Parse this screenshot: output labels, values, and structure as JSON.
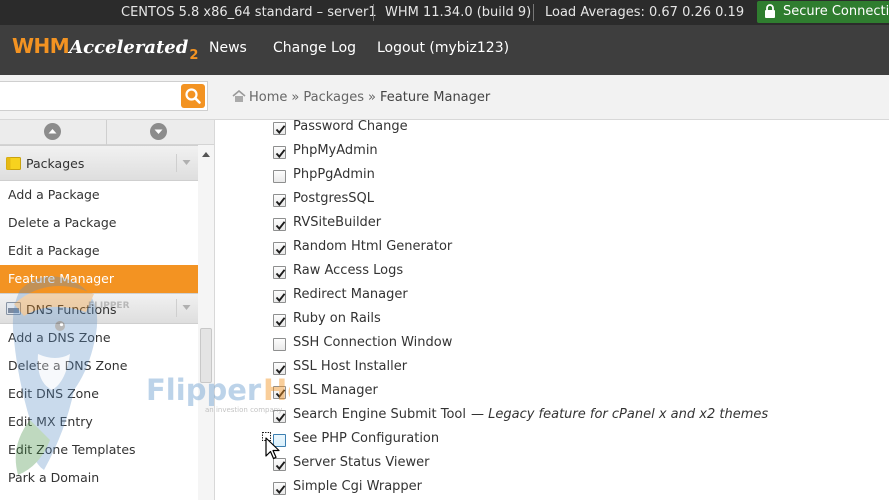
{
  "topbar": {
    "os": "CENTOS 5.8 x86_64 standard – server1",
    "version": "WHM 11.34.0 (build 9)",
    "load": "Load Averages: 0.67 0.26 0.19",
    "secure": "Secure Connection"
  },
  "header": {
    "logo_main": "WHM",
    "logo_accent": "Accelerated",
    "logo_num": "2",
    "nav": [
      "News",
      "Change Log",
      "Logout (mybiz123)"
    ]
  },
  "search": {
    "placeholder": "",
    "value": ""
  },
  "breadcrumb": {
    "home": "Home",
    "section": "Packages",
    "current": "Feature Manager",
    "sep": "»"
  },
  "sidebar": {
    "groups": [
      {
        "label": "Packages",
        "items": [
          {
            "label": "Add a Package",
            "active": false
          },
          {
            "label": "Delete a Package",
            "active": false
          },
          {
            "label": "Edit a Package",
            "active": false
          },
          {
            "label": "Feature Manager",
            "active": true
          }
        ]
      },
      {
        "label": "DNS Functions",
        "items": [
          {
            "label": "Add a DNS Zone",
            "active": false
          },
          {
            "label": "Delete a DNS Zone",
            "active": false
          },
          {
            "label": "Edit DNS Zone",
            "active": false
          },
          {
            "label": "Edit MX Entry",
            "active": false
          },
          {
            "label": "Edit Zone Templates",
            "active": false
          },
          {
            "label": "Park a Domain",
            "active": false
          }
        ]
      }
    ]
  },
  "watermark": {
    "text_a": "Flipper",
    "text_b": "Host",
    "tagline": "an investion company",
    "badge": "FLIPPER"
  },
  "features": [
    {
      "label": "Password Change",
      "checked": true
    },
    {
      "label": "PhpMyAdmin",
      "checked": true
    },
    {
      "label": "PhpPgAdmin",
      "checked": false
    },
    {
      "label": "PostgresSQL",
      "checked": true
    },
    {
      "label": "RVSiteBuilder",
      "checked": true
    },
    {
      "label": "Random Html Generator",
      "checked": true
    },
    {
      "label": "Raw Access Logs",
      "checked": true
    },
    {
      "label": "Redirect Manager",
      "checked": true
    },
    {
      "label": "Ruby on Rails",
      "checked": true
    },
    {
      "label": "SSH Connection Window",
      "checked": false
    },
    {
      "label": "SSL Host Installer",
      "checked": true
    },
    {
      "label": "SSL Manager",
      "checked": true
    },
    {
      "label": "Search Engine Submit Tool",
      "checked": true,
      "note": "— Legacy feature for cPanel x and x2 themes"
    },
    {
      "label": "See PHP Configuration",
      "checked": false,
      "hover": true
    },
    {
      "label": "Server Status Viewer",
      "checked": true
    },
    {
      "label": "Simple Cgi Wrapper",
      "checked": true
    }
  ],
  "colors": {
    "accent": "#f39322",
    "header": "#3e3e3e",
    "topbar": "#2b2b2b",
    "secure": "#2f7d2f"
  }
}
